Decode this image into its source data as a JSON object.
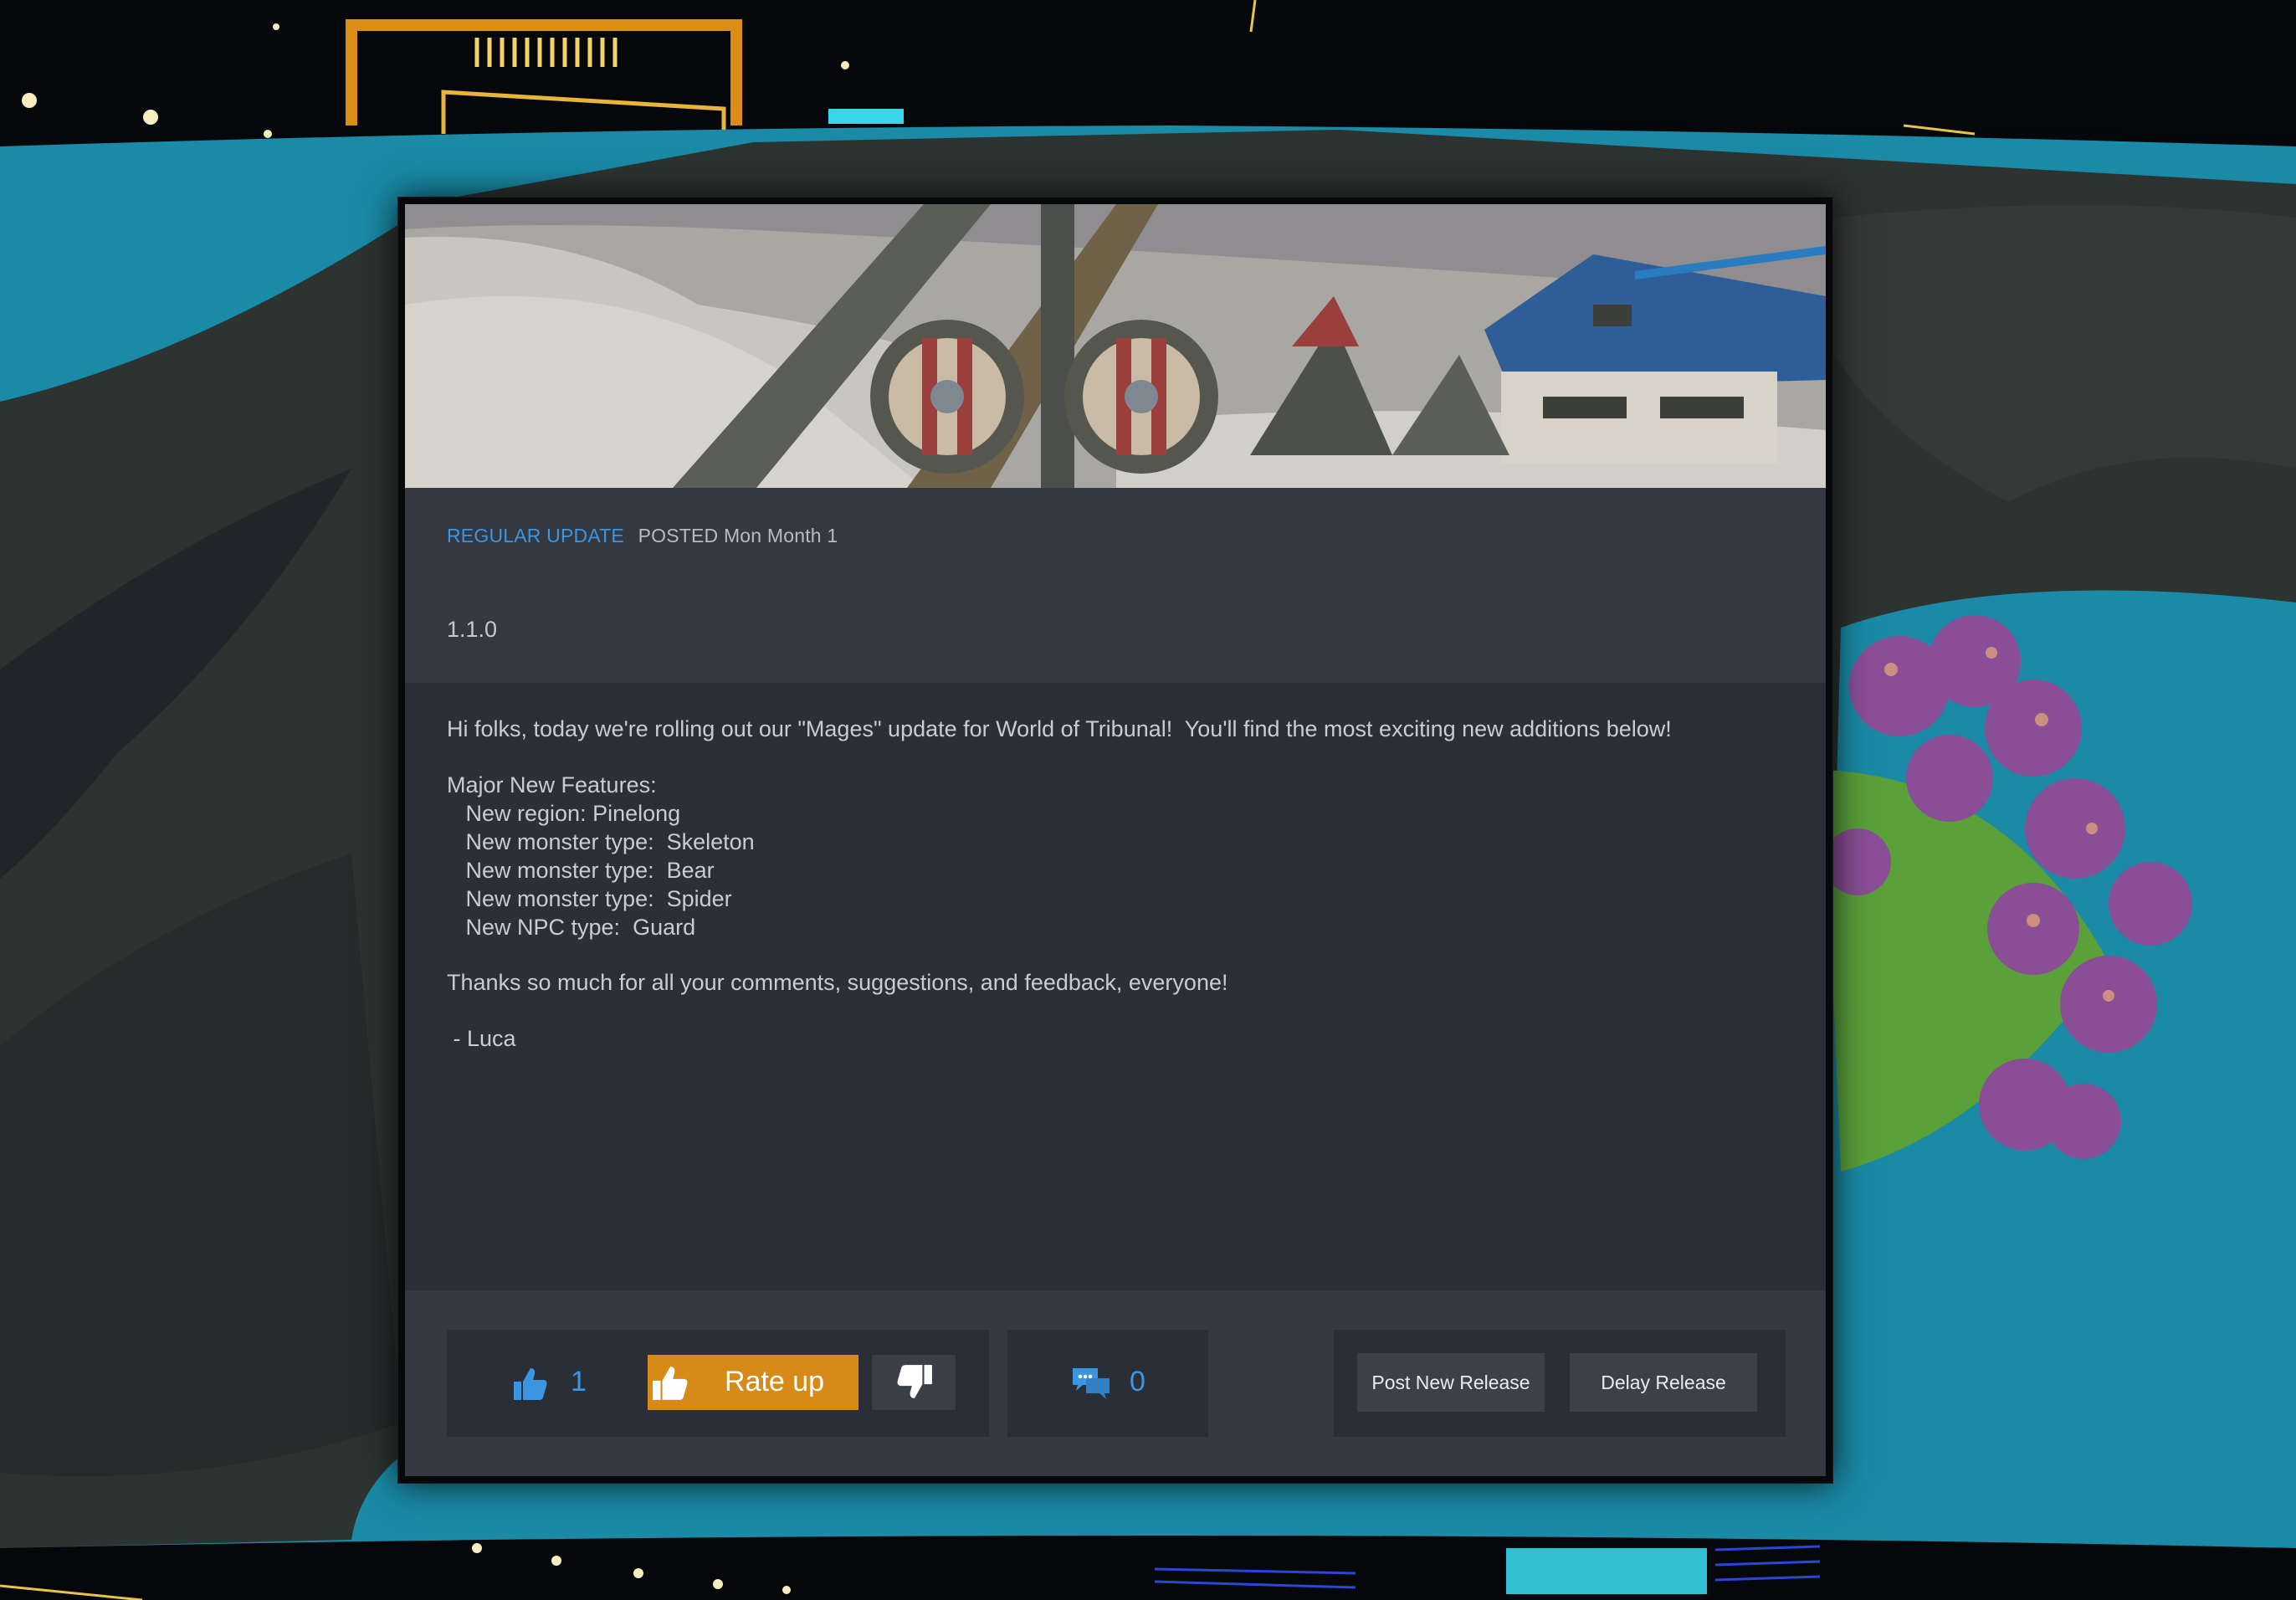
{
  "patch_note": {
    "category": "REGULAR UPDATE",
    "posted_label": "POSTED",
    "posted_date": "Mon Month 1",
    "version": "1.1.0",
    "body_lines": [
      "Hi folks, today we're rolling out our \"Mages\" update for World of Tribunal!  You'll find the most exciting new additions below!",
      "",
      "Major New Features:",
      "   New region: Pinelong",
      "   New monster type:  Skeleton",
      "   New monster type:  Bear",
      "   New monster type:  Spider",
      "   New NPC type:  Guard",
      "",
      "Thanks so much for all your comments, suggestions, and feedback, everyone!",
      "",
      " - Luca"
    ]
  },
  "rating": {
    "like_count": "1",
    "rate_up_label": "Rate up"
  },
  "comments": {
    "count": "0"
  },
  "release_actions": {
    "post_label": "Post New Release",
    "delay_label": "Delay Release"
  },
  "colors": {
    "accent_blue": "#3b95e0",
    "rate_up_orange": "#d78a17",
    "panel_bg": "#2b2f37"
  },
  "icons": {
    "like": "thumbs-up-icon",
    "rate_up": "thumbs-up-icon",
    "rate_down": "thumbs-down-icon",
    "comments": "chat-bubbles-icon"
  }
}
